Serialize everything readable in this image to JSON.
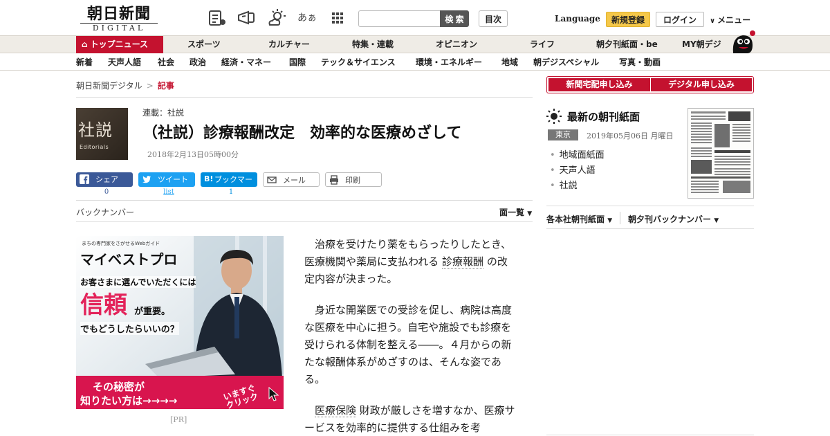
{
  "header": {
    "logo_jp": "朝日新聞",
    "logo_en": "DIGITAL",
    "search_placeholder": "",
    "search_label": "検 索",
    "toc_label": "目次",
    "language_label": "Language",
    "register_label": "新規登録",
    "login_label": "ログイン",
    "menu_label": "メニュー",
    "font_icon_text": "あぁ"
  },
  "global_nav": {
    "top_label": "トップニュース",
    "items": [
      "スポーツ",
      "カルチャー",
      "特集・連載",
      "オピニオン",
      "ライフ",
      "朝夕刊紙面・be",
      "MY朝デジ"
    ]
  },
  "category_nav": {
    "items": [
      "新着",
      "天声人語",
      "社会",
      "政治",
      "経済・マネー",
      "国際",
      "テック＆サイエンス",
      "環境・エネルギー",
      "地域",
      "朝デジスペシャル",
      "写真・動画"
    ]
  },
  "breadcrumb": {
    "home": "朝日新聞デジタル",
    "sep": ">",
    "current": "記事"
  },
  "article": {
    "thumb_kanji": "社説",
    "thumb_en": "Editorials",
    "series": "連載：社説",
    "title": "（社説）診療報酬改定　効率的な医療めざして",
    "date": "2018年2月13日05時00分",
    "p1_a": "治療を受けたり薬をもらったりしたとき、医療機関や薬局に支払われる",
    "p1_kw": "診療報酬",
    "p1_b": "の改定内容が決まった。",
    "p2": "身近な開業医での受診を促し、病院は高度な医療を中心に担う。自宅や施設でも診療を受けられる体制を整える――。４月からの新たな報酬体系がめざすのは、そんな姿である。",
    "p3_kw": "医療保険",
    "p3_b": "財政が厳しさを増すなか、医療サービスを効率的に提供する仕組みを考"
  },
  "share": {
    "facebook_label": "シェア",
    "facebook_count": "0",
    "twitter_label": "ツイート",
    "twitter_count": "list",
    "hatena_label": "ブックマーク",
    "hatena_count": "1",
    "mail_label": "メール",
    "print_label": "印刷"
  },
  "backnumber": {
    "label": "バックナンバー",
    "page_list": "面一覧"
  },
  "ad": {
    "kicker": "まちの専門家をさがせるWebガイド",
    "brand": "マイベストプロ",
    "line1": "お客さまに選んでいただくには",
    "big": "信頼",
    "line2": "が重要。",
    "line3": "でもどうしたらいいの？",
    "cta1": "その秘密が",
    "cta2": "知りたい方は→→→→",
    "click": "いますぐ クリック",
    "pr": "[PR]"
  },
  "sidebar": {
    "order_paper": "新聞宅配申し込み",
    "order_digital": "デジタル申し込み",
    "latest_title": "最新の朝刊紙面",
    "edition": "東京",
    "edition_date": "2019年05月06日 月曜日",
    "links": [
      "地域面紙面",
      "天声人語",
      "社説"
    ],
    "bureau_dropdown": "各本社朝刊紙面",
    "backnumber_dropdown": "朝夕刊バックナンバー"
  },
  "colors": {
    "brand_red": "#c4122f",
    "facebook": "#3b5998",
    "twitter": "#1da1f2",
    "hatena": "#008fde",
    "register": "#f5c84a"
  }
}
